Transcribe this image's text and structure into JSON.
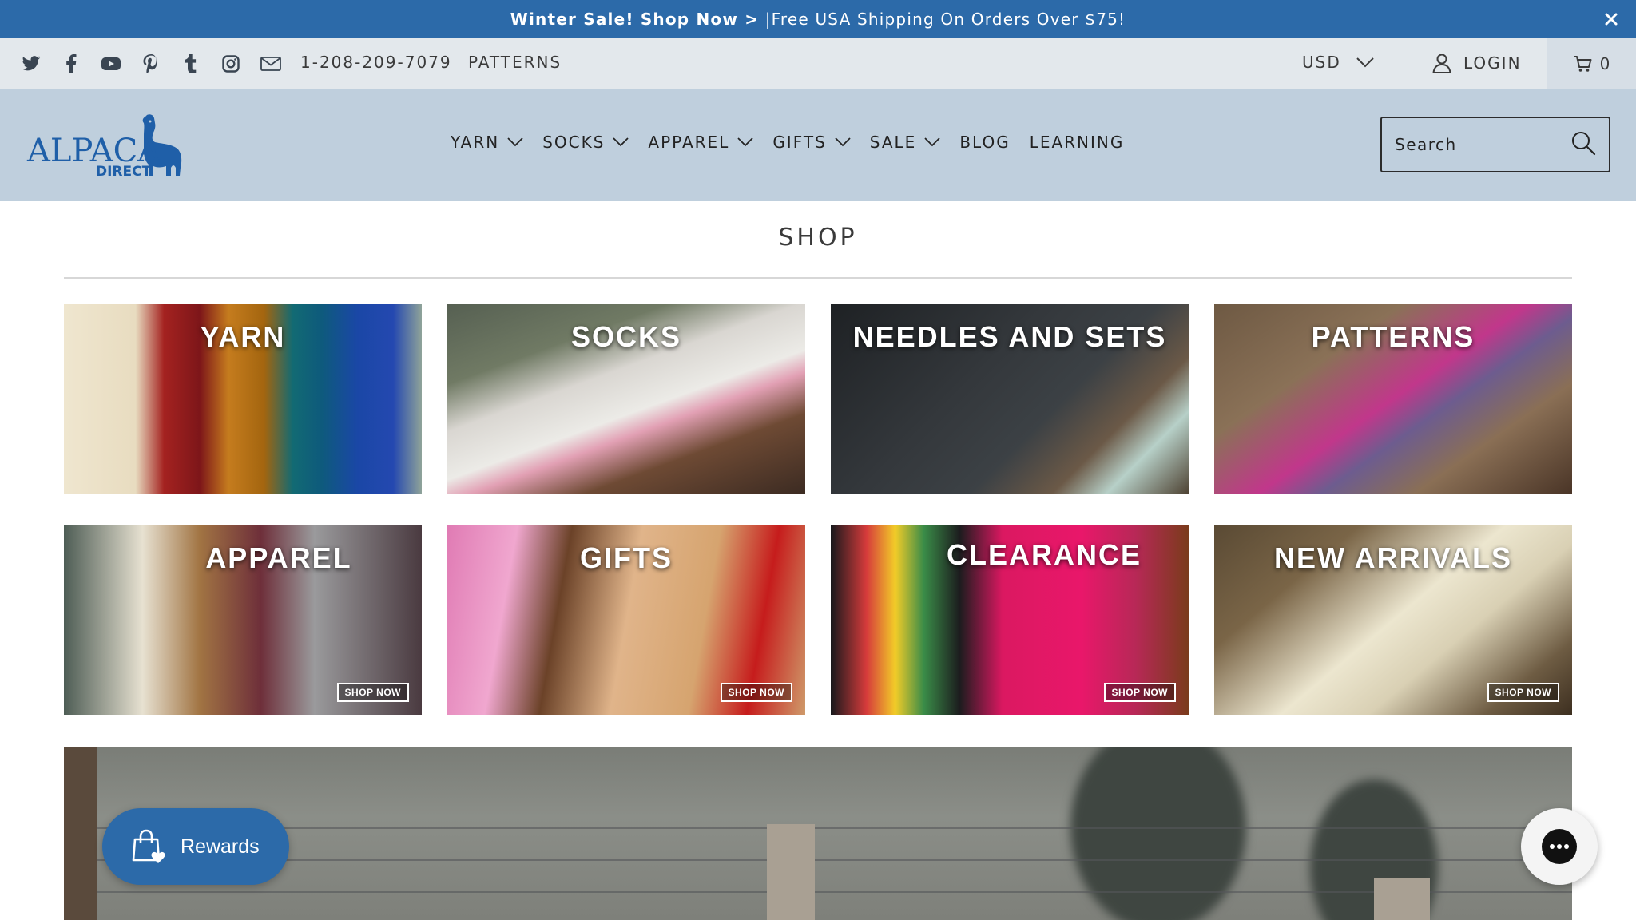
{
  "announcement": {
    "bold": "Winter Sale! Shop Now >",
    "text": " |Free USA Shipping On Orders Over $75!"
  },
  "utility": {
    "social_icons": [
      "twitter-icon",
      "facebook-icon",
      "youtube-icon",
      "pinterest-icon",
      "tumblr-icon",
      "instagram-icon",
      "mail-icon"
    ],
    "phone": "1-208-209-7079",
    "patterns_link": "PATTERNS",
    "currency": "USD",
    "login": "LOGIN",
    "cart_count": "0"
  },
  "header": {
    "logo_line1": "ALPACA",
    "logo_line2": "DIRECT",
    "nav": [
      {
        "label": "YARN",
        "dropdown": true
      },
      {
        "label": "SOCKS",
        "dropdown": true
      },
      {
        "label": "APPAREL",
        "dropdown": true
      },
      {
        "label": "GIFTS",
        "dropdown": true
      },
      {
        "label": "SALE",
        "dropdown": true
      },
      {
        "label": "BLOG",
        "dropdown": false
      },
      {
        "label": "LEARNING",
        "dropdown": false
      }
    ],
    "search_placeholder": "Search"
  },
  "shop": {
    "title": "SHOP",
    "tiles": [
      {
        "label": "YARN"
      },
      {
        "label": "SOCKS"
      },
      {
        "label": "NEEDLES AND SETS"
      },
      {
        "label": "PATTERNS"
      },
      {
        "label": "APPAREL",
        "cta": "SHOP NOW"
      },
      {
        "label": "GIFTS",
        "cta": "SHOP NOW"
      },
      {
        "label": "CLEARANCE",
        "cta": "SHOP NOW"
      },
      {
        "label": "NEW ARRIVALS",
        "cta": "SHOP NOW"
      }
    ]
  },
  "widgets": {
    "rewards_label": "Rewards"
  },
  "colors": {
    "announcement_bg": "#2c6aa9",
    "utility_bg": "#e3e8ec",
    "header_bg": "#bfcfdd",
    "brand_blue": "#1f5fa8"
  }
}
